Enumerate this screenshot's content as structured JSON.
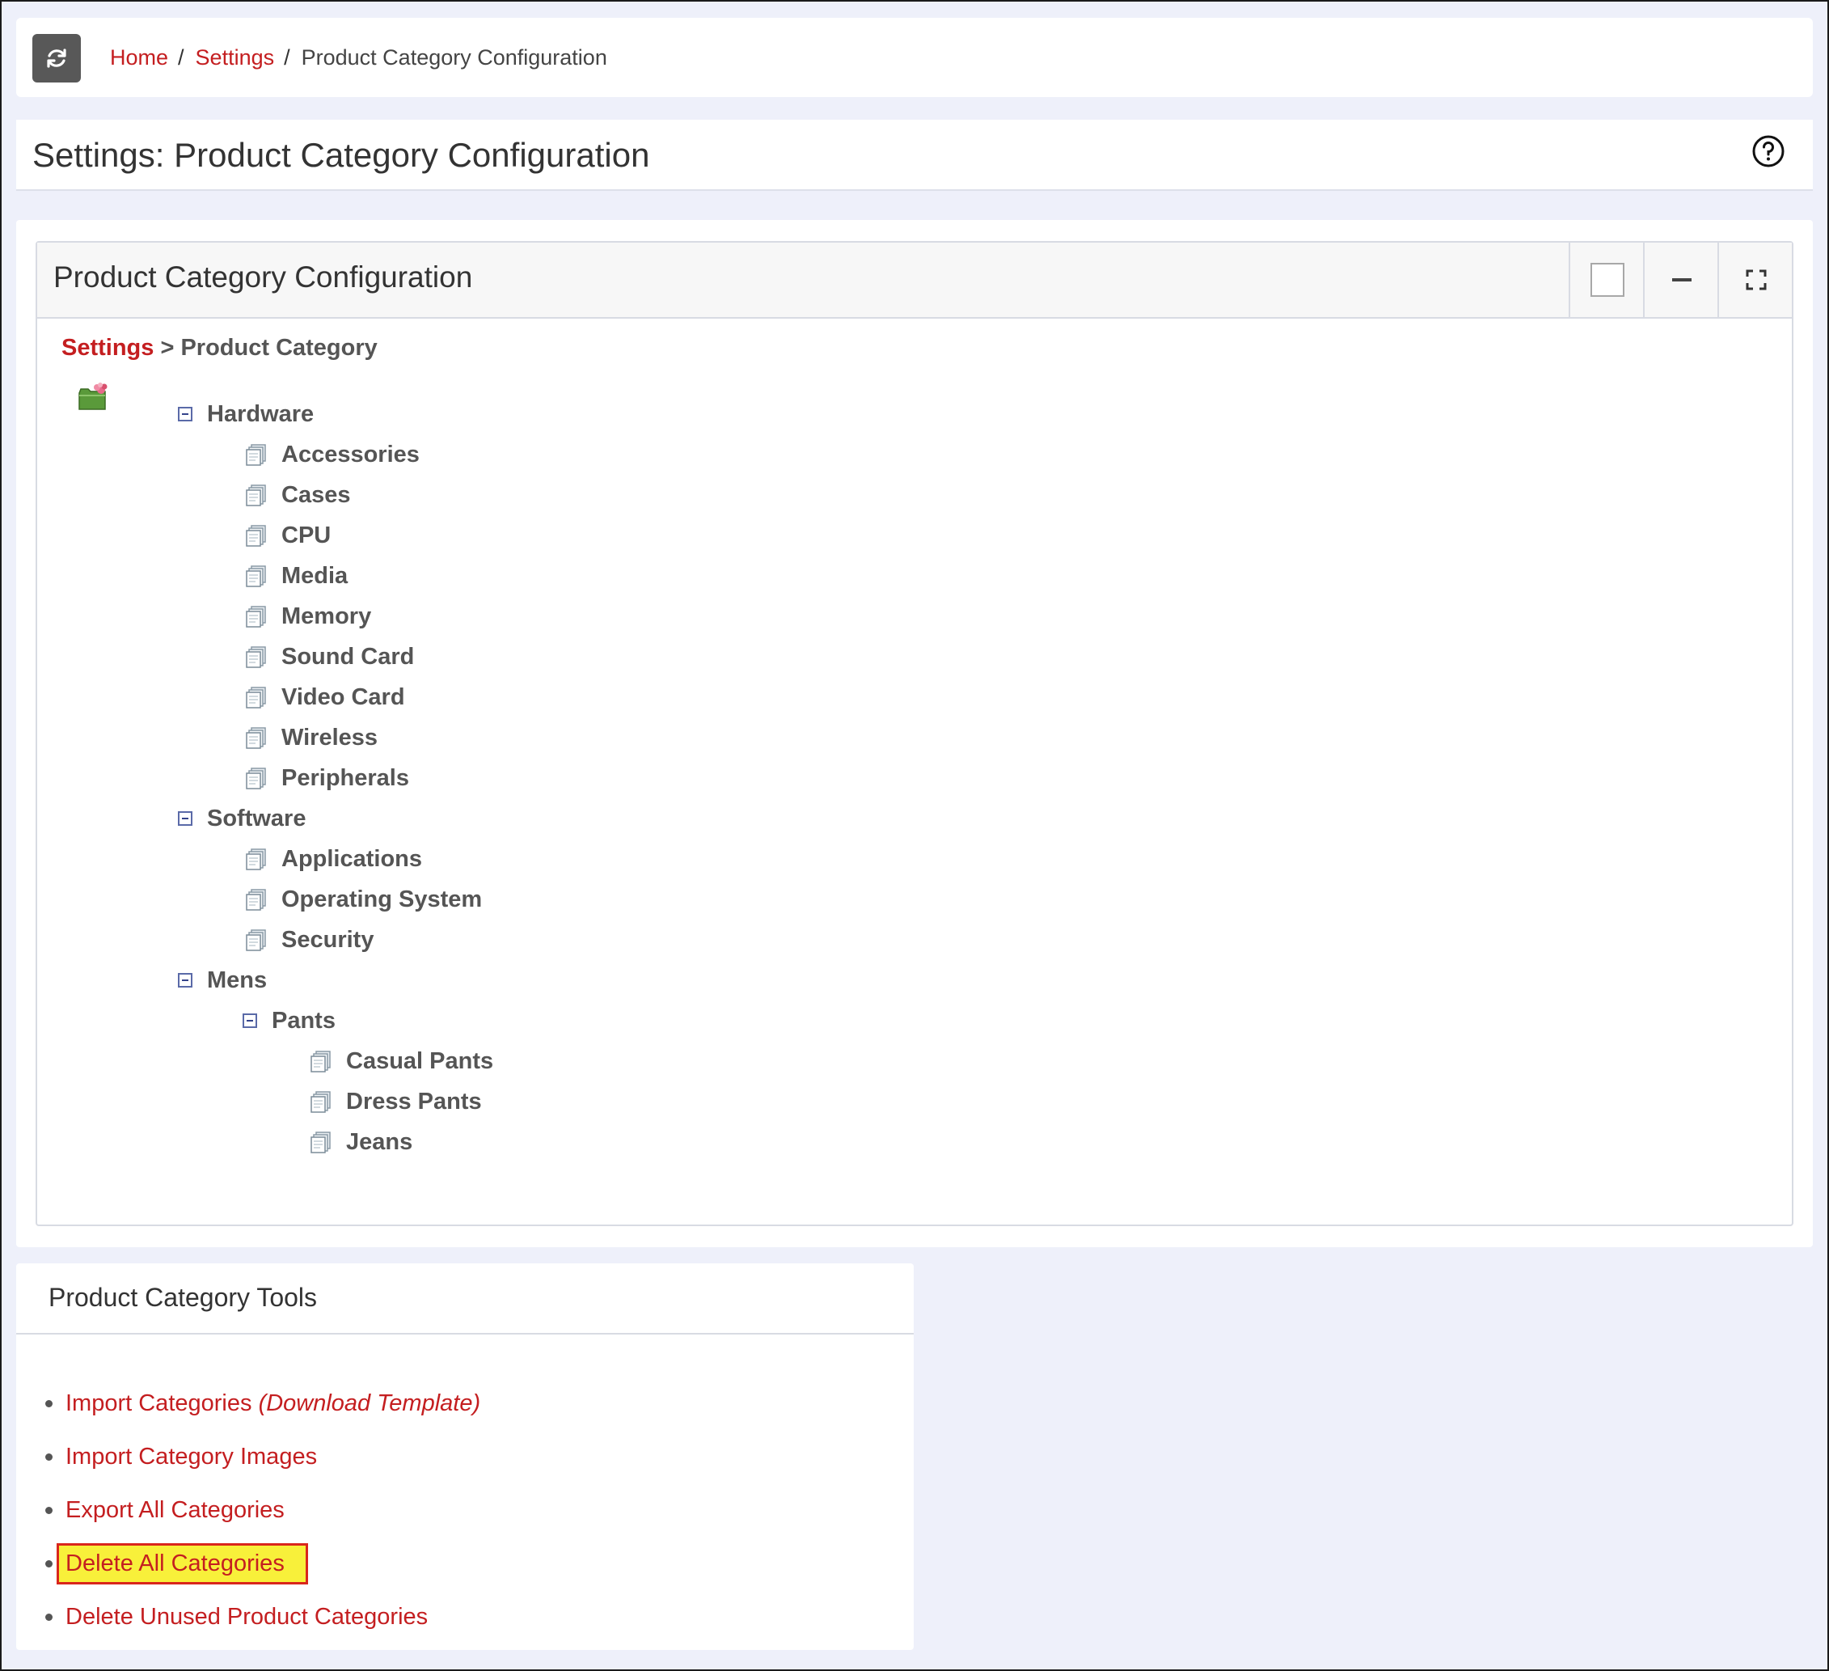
{
  "breadcrumb": {
    "home": "Home",
    "settings": "Settings",
    "current": "Product Category Configuration"
  },
  "page": {
    "title": "Settings: Product Category Configuration"
  },
  "panel": {
    "title": "Product Category Configuration",
    "path_link": "Settings",
    "path_rest": " > Product Category"
  },
  "tree": {
    "groups": [
      {
        "label": "Hardware",
        "children": [
          "Accessories",
          "Cases",
          "CPU",
          "Media",
          "Memory",
          "Sound Card",
          "Video Card",
          "Wireless",
          "Peripherals"
        ]
      },
      {
        "label": "Software",
        "children": [
          "Applications",
          "Operating System",
          "Security"
        ]
      },
      {
        "label": "Mens",
        "subgroup": {
          "label": "Pants",
          "children": [
            "Casual Pants",
            "Dress Pants",
            "Jeans"
          ]
        }
      }
    ]
  },
  "tools": {
    "title": "Product Category Tools",
    "items": [
      {
        "label": "Import Categories",
        "extra": "(Download Template)"
      },
      {
        "label": "Import Category Images"
      },
      {
        "label": "Export All Categories"
      },
      {
        "label": "Delete All Categories",
        "highlighted": true
      },
      {
        "label": "Delete Unused Product Categories"
      }
    ]
  },
  "icons": {
    "refresh": "refresh-icon",
    "help": "help-circle-icon",
    "panel_select": "checkbox-icon",
    "panel_minimize": "minimize-icon",
    "panel_expand": "expand-icon",
    "tree_root": "folder-root-icon",
    "tree_toggle": "collapse-toggle-icon",
    "tree_leaf": "category-leaf-icon"
  },
  "colors": {
    "link": "#c41e20",
    "highlight": "#f8f03a",
    "highlight_border": "#d9261c",
    "background": "#eef0fa"
  }
}
